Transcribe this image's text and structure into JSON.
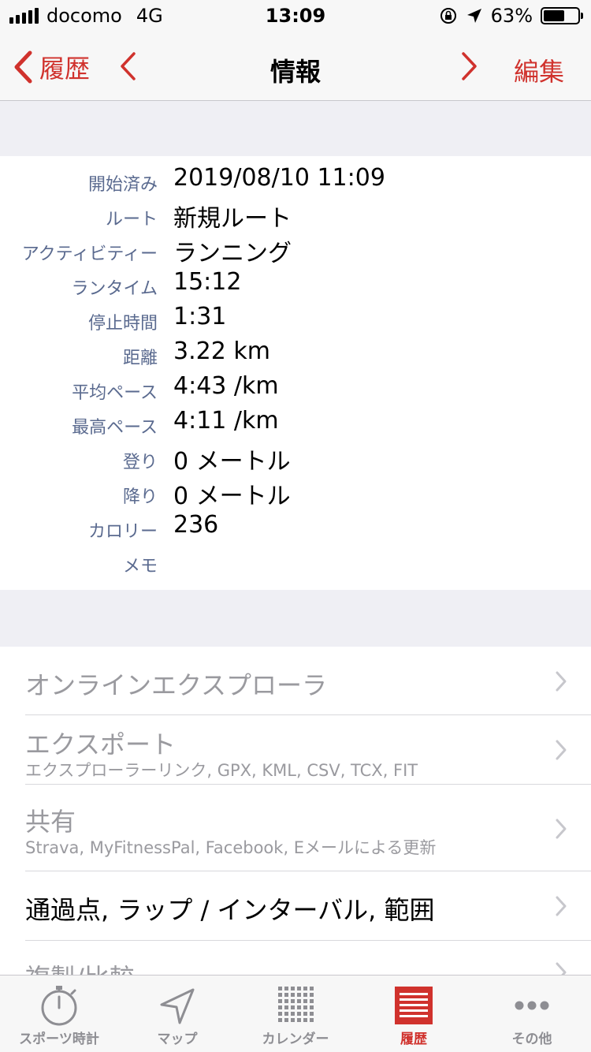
{
  "status_bar": {
    "carrier": "docomo",
    "network": "4G",
    "time": "13:09",
    "battery": "63%",
    "battery_level": 0.63
  },
  "nav": {
    "back_label": "履歴",
    "title": "情報",
    "edit_label": "編集"
  },
  "info_rows": [
    {
      "label": "開始済み",
      "value": "2019/08/10 11:09"
    },
    {
      "label": "ルート",
      "value": "新規ルート"
    },
    {
      "label": "アクティビティー",
      "value": "ランニング"
    },
    {
      "label": "ランタイム",
      "value": "15:12"
    },
    {
      "label": "停止時間",
      "value": "1:31"
    },
    {
      "label": "距離",
      "value": "3.22 km"
    },
    {
      "label": "平均ペース",
      "value": "4:43 /km"
    },
    {
      "label": "最高ペース",
      "value": "4:11 /km"
    },
    {
      "label": "登り",
      "value": "0 メートル"
    },
    {
      "label": "降り",
      "value": "0 メートル"
    },
    {
      "label": "カロリー",
      "value": "236"
    },
    {
      "label": "メモ",
      "value": ""
    }
  ],
  "menu": [
    {
      "title": "オンラインエクスプローラ",
      "subtitle": ""
    },
    {
      "title": "エクスポート",
      "subtitle": "エクスプローラーリンク, GPX, KML, CSV, TCX, FIT"
    },
    {
      "title": "共有",
      "subtitle": "Strava, MyFitnessPal, Facebook, Eメールによる更新"
    },
    {
      "title": "通過点, ラップ / インターバル, 範囲",
      "subtitle": ""
    },
    {
      "title": "複製/比較",
      "subtitle": ""
    }
  ],
  "tabs": [
    {
      "label": "スポーツ時計",
      "icon": "stopwatch-icon"
    },
    {
      "label": "マップ",
      "icon": "location-arrow-icon"
    },
    {
      "label": "カレンダー",
      "icon": "calendar-grid-icon"
    },
    {
      "label": "履歴",
      "icon": "history-list-icon",
      "active": true
    },
    {
      "label": "その他",
      "icon": "more-dots-icon"
    }
  ],
  "colors": {
    "accent": "#d0322d",
    "label": "#5a6a8f",
    "disabled": "#9a9a9f",
    "background": "#efeff4"
  }
}
